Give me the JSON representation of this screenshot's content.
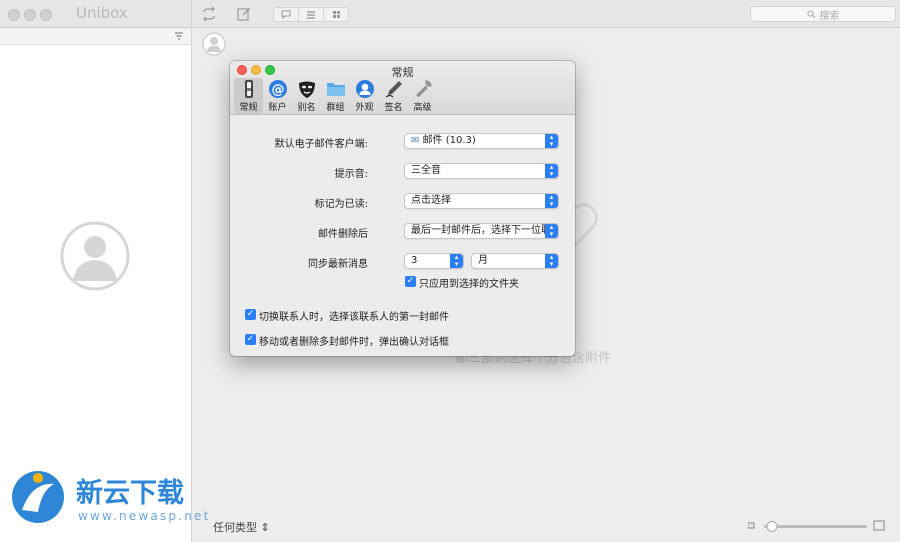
{
  "app": {
    "title": "Unibox"
  },
  "toolbar": {
    "search_placeholder": "搜索"
  },
  "main": {
    "bg_text": "都三部到迷择个分包含附件",
    "filter_label": "任何类型 ⇕"
  },
  "watermark": {
    "brand": "新云下载",
    "url": "www.newasp.net"
  },
  "prefs": {
    "title": "常规",
    "tabs": [
      {
        "label": "常规",
        "icon": "switch-icon"
      },
      {
        "label": "账户",
        "icon": "at-icon"
      },
      {
        "label": "别名",
        "icon": "mask-icon"
      },
      {
        "label": "群组",
        "icon": "folder-icon"
      },
      {
        "label": "外观",
        "icon": "person-icon"
      },
      {
        "label": "签名",
        "icon": "pen-icon"
      },
      {
        "label": "高级",
        "icon": "wrench-icon"
      }
    ],
    "default_client": {
      "label": "默认电子邮件客户端:",
      "value": "邮件 (10.3)"
    },
    "sound": {
      "label": "提示音:",
      "value": "三全音"
    },
    "mark_read": {
      "label": "标记为已读:",
      "value": "点击选择"
    },
    "after_delete": {
      "label": "邮件删除后",
      "value": "最后一封邮件后，选择下一位联..."
    },
    "sync": {
      "label": "同步最新消息",
      "count": "3",
      "unit": "月"
    },
    "apply_selected": {
      "label": "只应用到选择的文件夹",
      "checked": true
    },
    "switch_contact": {
      "label": "切换联系人时，选择该联系人的第一封邮件",
      "checked": true
    },
    "confirm_move": {
      "label": "移动或者删除多封邮件时，弹出确认对话框",
      "checked": true
    }
  },
  "colors": {
    "accent": "#2c7ff2",
    "close": "#fc605b",
    "minimize": "#fdbc40",
    "zoom": "#34c84a"
  }
}
